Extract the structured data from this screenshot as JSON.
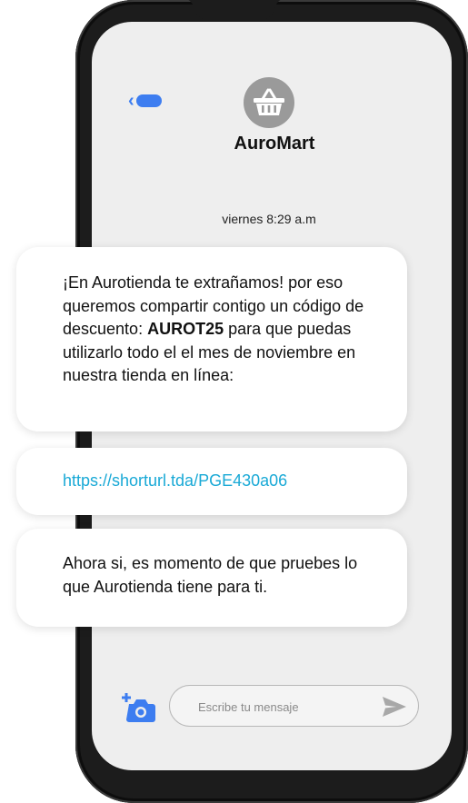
{
  "header": {
    "contact_name": "AuroMart",
    "back_icon": "chevron-left-icon",
    "avatar_icon": "shopping-basket-icon"
  },
  "conversation": {
    "timestamp": "viernes 8:29 a.m",
    "messages": [
      {
        "before": "¡En Aurotienda te extrañamos! por eso queremos compartir contigo un código de descuento: ",
        "code": "AUROT25",
        "after": " para que puedas utilizarlo todo el el mes de noviembre en nuestra tienda en línea:"
      },
      {
        "link": "https://shorturl.tda/PGE430a06"
      },
      {
        "text": "Ahora si, es momento de que pruebes lo que Aurotienda tiene para ti."
      }
    ]
  },
  "composer": {
    "placeholder": "Escribe tu mensaje",
    "attach_icon": "add-photo-icon",
    "send_icon": "send-icon"
  },
  "colors": {
    "accent": "#3d7df0",
    "link": "#19a9d6",
    "avatar_bg": "#9a9a9a",
    "screen_bg": "#eeeeee"
  }
}
